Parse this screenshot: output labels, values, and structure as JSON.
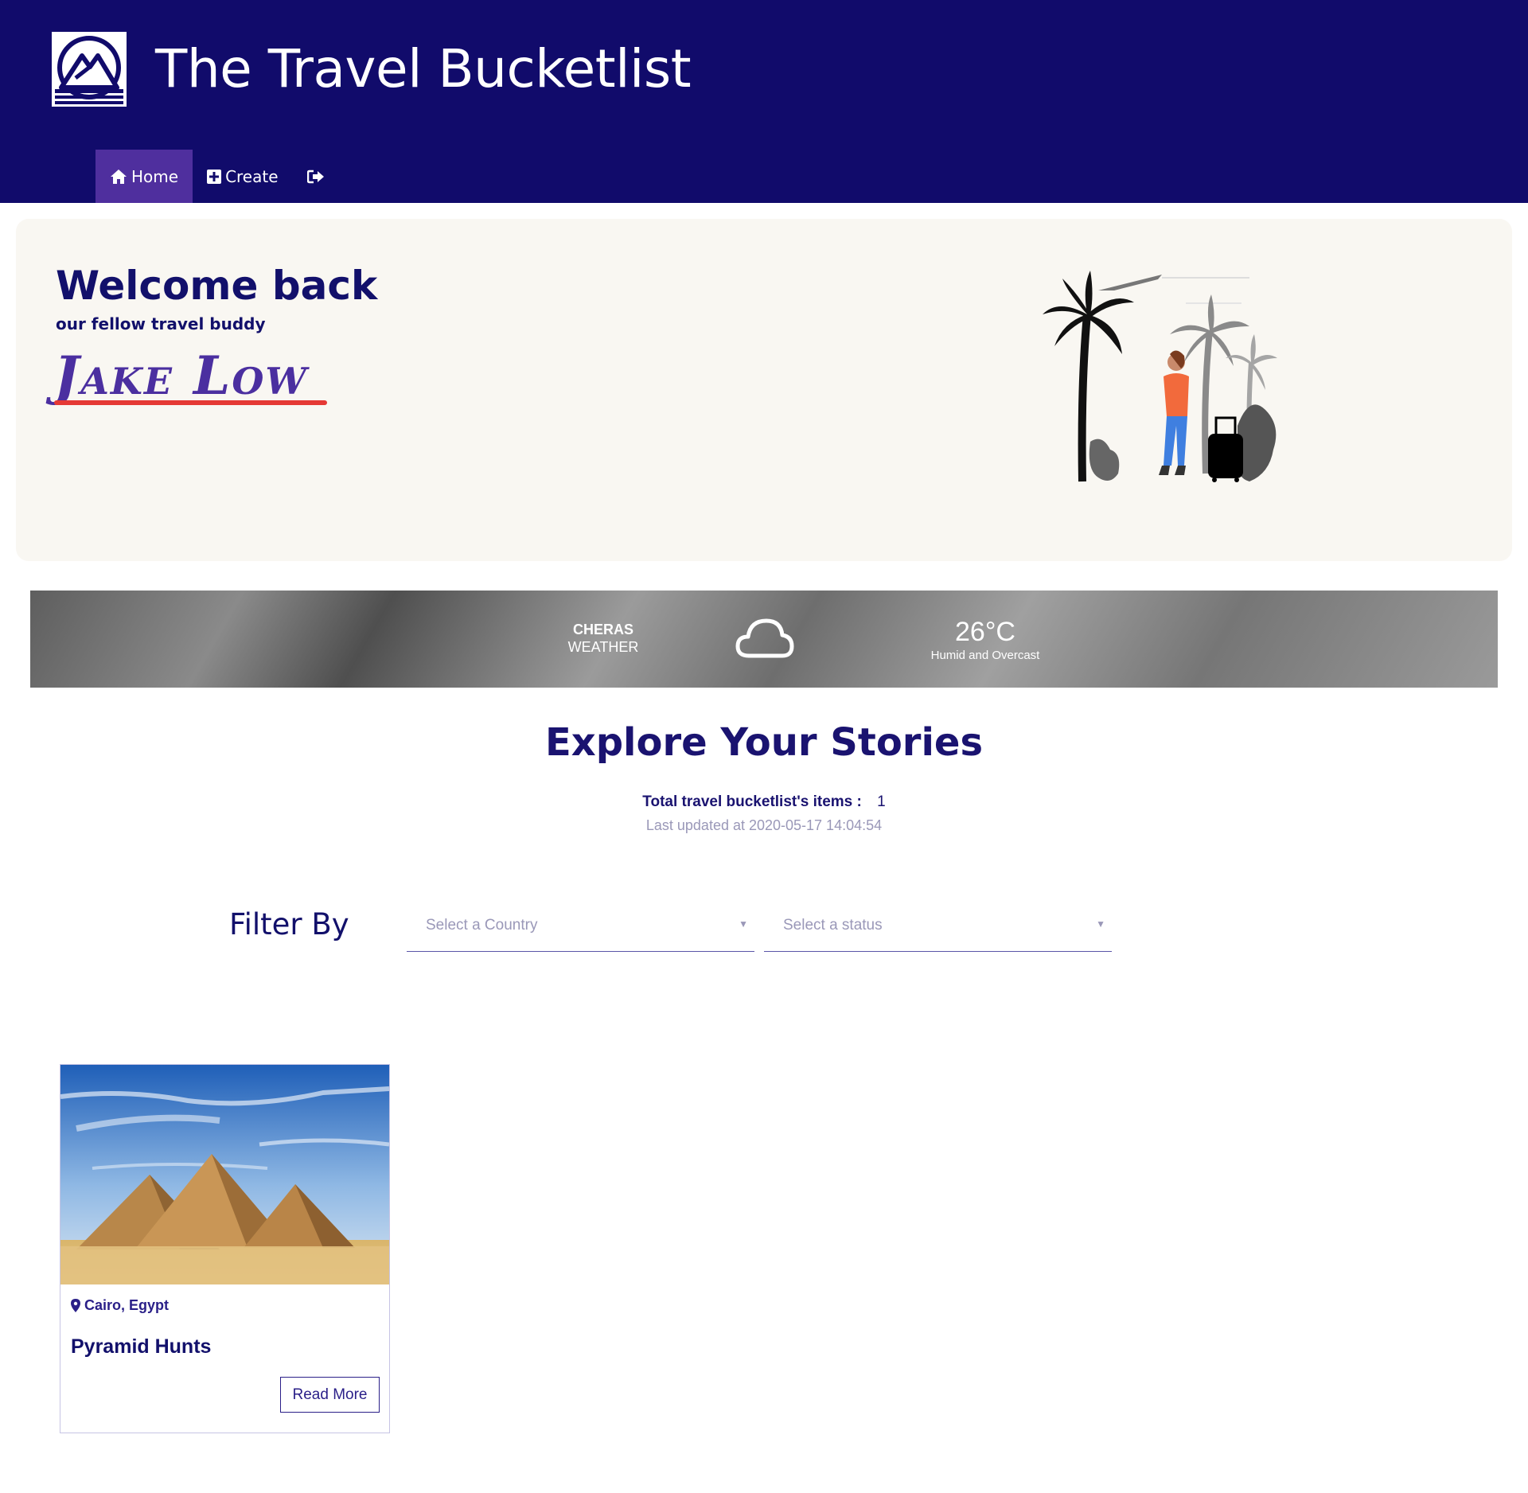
{
  "header": {
    "title": "The Travel Bucketlist",
    "logo_icon": "mountain-logo-icon",
    "background_color": "#110b6b"
  },
  "nav": {
    "items": [
      {
        "label": "Home",
        "icon": "home-icon",
        "active": true
      },
      {
        "label": "Create",
        "icon": "plus-square-icon",
        "active": false
      },
      {
        "label": "",
        "icon": "sign-out-icon",
        "active": false
      }
    ]
  },
  "welcome": {
    "title": "Welcome back",
    "subtitle": "our fellow travel buddy",
    "user_name": "Jake Low"
  },
  "weather": {
    "city": "CHERAS",
    "label": "WEATHER",
    "icon": "cloud-icon",
    "temperature": "26°C",
    "description": "Humid and Overcast"
  },
  "explore": {
    "title": "Explore Your Stories",
    "total_label": "Total travel bucketlist's items :",
    "total_count": "1",
    "last_updated": "Last updated at 2020-05-17 14:04:54"
  },
  "filter": {
    "label": "Filter By",
    "country_placeholder": "Select a Country",
    "status_placeholder": "Select a status"
  },
  "cards": [
    {
      "location": "Cairo, Egypt",
      "title": "Pyramid Hunts",
      "button_label": "Read More",
      "image": "pyramids-image"
    }
  ],
  "colors": {
    "primary": "#110b6b",
    "accent": "#4f2f9e",
    "underline": "#e53935"
  }
}
